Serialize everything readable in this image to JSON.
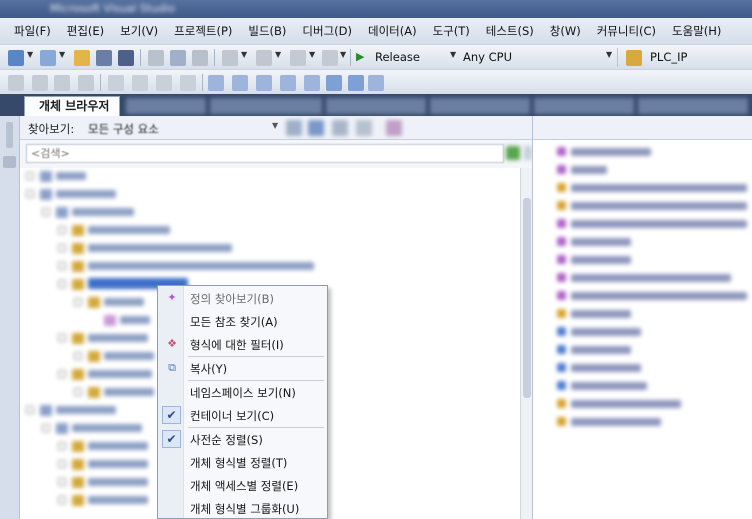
{
  "window": {
    "title": "Microsoft Visual Studio"
  },
  "menubar": {
    "items": [
      "파일(F)",
      "편집(E)",
      "보기(V)",
      "프로젝트(P)",
      "빌드(B)",
      "디버그(D)",
      "데이터(A)",
      "도구(T)",
      "테스트(S)",
      "창(W)",
      "커뮤니티(C)",
      "도움말(H)"
    ]
  },
  "toolbar": {
    "configuration": "Release",
    "platform": "Any CPU",
    "startup_item": "PLC_IP"
  },
  "object_browser": {
    "tab_label": "개체 브라우저",
    "browse_label": "찾아보기:",
    "browse_scope": "모든 구성 요소",
    "search_placeholder": "<검색>"
  },
  "context_menu": {
    "items": [
      {
        "label": "정의 찾아보기(B)",
        "icon": "go-to-definition-icon",
        "dim": true
      },
      {
        "label": "모든 참조 찾기(A)"
      },
      {
        "label": "형식에 대한 필터(I)",
        "icon": "filter-icon"
      },
      {
        "label": "복사(Y)",
        "icon": "copy-icon"
      },
      {
        "label": "네임스페이스 보기(N)"
      },
      {
        "label": "컨테이너 보기(C)",
        "checked": true
      },
      {
        "label": "사전순 정렬(S)",
        "checked": true
      },
      {
        "label": "개체 형식별 정렬(T)"
      },
      {
        "label": "개체 액세스별 정렬(E)"
      },
      {
        "label": "개체 형식별 그룹화(U)"
      }
    ]
  },
  "colors": {
    "accent": "#3f5a87",
    "tab_strip": "#36496a",
    "menu_check": "#dbe6f6"
  }
}
